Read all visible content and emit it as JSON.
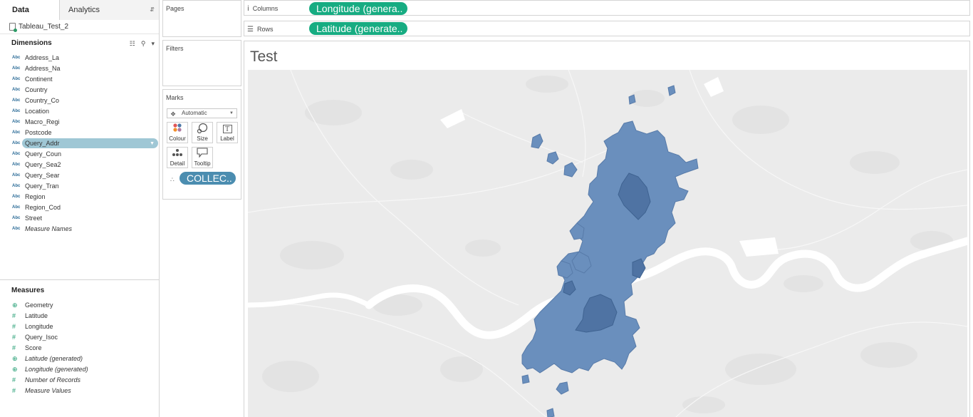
{
  "tabs": {
    "data": "Data",
    "analytics": "Analytics"
  },
  "datasource": "Tableau_Test_2",
  "dimensions": {
    "header": "Dimensions",
    "items": [
      {
        "type": "Abc",
        "name": "Address_La",
        "italic": false
      },
      {
        "type": "Abc",
        "name": "Address_Na",
        "italic": false
      },
      {
        "type": "Abc",
        "name": "Continent",
        "italic": false
      },
      {
        "type": "Abc",
        "name": "Country",
        "italic": false
      },
      {
        "type": "Abc",
        "name": "Country_Co",
        "italic": false
      },
      {
        "type": "Abc",
        "name": "Location",
        "italic": false
      },
      {
        "type": "Abc",
        "name": "Macro_Regi",
        "italic": false
      },
      {
        "type": "Abc",
        "name": "Postcode",
        "italic": false
      },
      {
        "type": "Abc",
        "name": "Query_Addr",
        "italic": false,
        "selected": true
      },
      {
        "type": "Abc",
        "name": "Query_Coun",
        "italic": false
      },
      {
        "type": "Abc",
        "name": "Query_Sea2",
        "italic": false
      },
      {
        "type": "Abc",
        "name": "Query_Sear",
        "italic": false
      },
      {
        "type": "Abc",
        "name": "Query_Tran",
        "italic": false
      },
      {
        "type": "Abc",
        "name": "Region",
        "italic": false
      },
      {
        "type": "Abc",
        "name": "Region_Cod",
        "italic": false
      },
      {
        "type": "Abc",
        "name": "Street",
        "italic": false
      },
      {
        "type": "Abc",
        "name": "Measure Names",
        "italic": true
      }
    ]
  },
  "measures": {
    "header": "Measures",
    "items": [
      {
        "type": "geo",
        "name": "Geometry",
        "italic": false
      },
      {
        "type": "num",
        "name": "Latitude",
        "italic": false
      },
      {
        "type": "num",
        "name": "Longitude",
        "italic": false
      },
      {
        "type": "num",
        "name": "Query_Isoc",
        "italic": false
      },
      {
        "type": "num",
        "name": "Score",
        "italic": false
      },
      {
        "type": "geo",
        "name": "Latitude (generated)",
        "italic": true
      },
      {
        "type": "geo",
        "name": "Longitude (generated)",
        "italic": true
      },
      {
        "type": "num",
        "name": "Number of Records",
        "italic": true
      },
      {
        "type": "num",
        "name": "Measure Values",
        "italic": true
      }
    ]
  },
  "cards": {
    "pages": "Pages",
    "filters": "Filters",
    "marks": "Marks",
    "mark_type": "Automatic",
    "buttons": {
      "colour": "Colour",
      "size": "Size",
      "label": "Label",
      "detail": "Detail",
      "tooltip": "Tooltip"
    },
    "detail_pill": "COLLEC.."
  },
  "shelves": {
    "columns_label": "Columns",
    "columns_pill": "Longitude (genera..",
    "rows_label": "Rows",
    "rows_pill": "Latitude (generate.."
  },
  "viz": {
    "title": "Test"
  },
  "colors": {
    "green_pill": "#17ac82",
    "blue_pill": "#4b8db0",
    "selected_field": "#9fc7d5",
    "map_bg": "#ebebeb",
    "polygon_fill": "#6a8fbd",
    "polygon_dark": "#4f73a3"
  }
}
